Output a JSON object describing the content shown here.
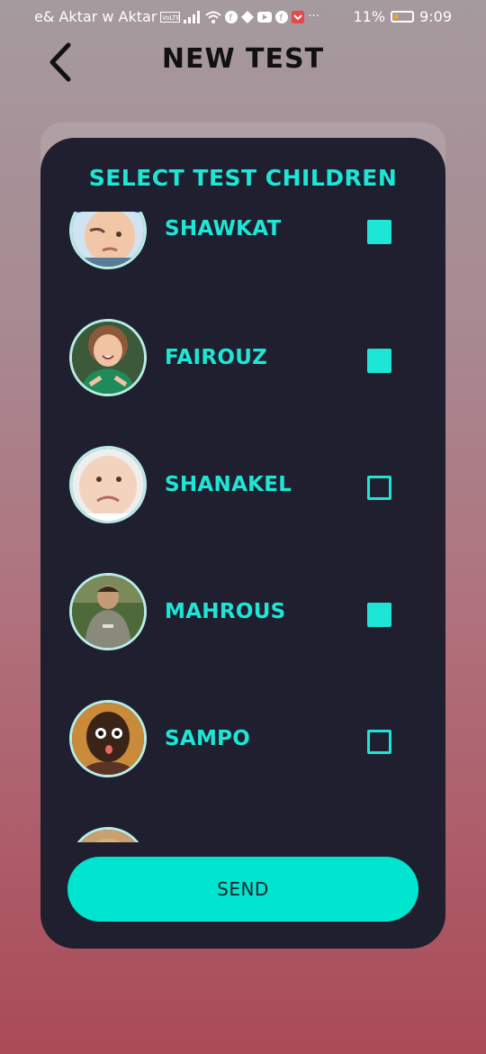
{
  "status_bar": {
    "carrier": "e& Aktar w Aktar",
    "battery": "11%",
    "time": "9:09"
  },
  "header": {
    "title": "NEW TEST"
  },
  "card": {
    "title": "SELECT TEST CHILDREN",
    "children": [
      {
        "name": "SHAWKAT",
        "checked": true
      },
      {
        "name": "FAIROUZ",
        "checked": true
      },
      {
        "name": "SHANAKEL",
        "checked": false
      },
      {
        "name": "MAHROUS",
        "checked": true
      },
      {
        "name": "SAMPO",
        "checked": false
      }
    ],
    "send_label": "SEND"
  },
  "colors": {
    "accent": "#1ee6d6",
    "card_bg": "#1f1f2f",
    "button_bg": "#00e5d0"
  }
}
